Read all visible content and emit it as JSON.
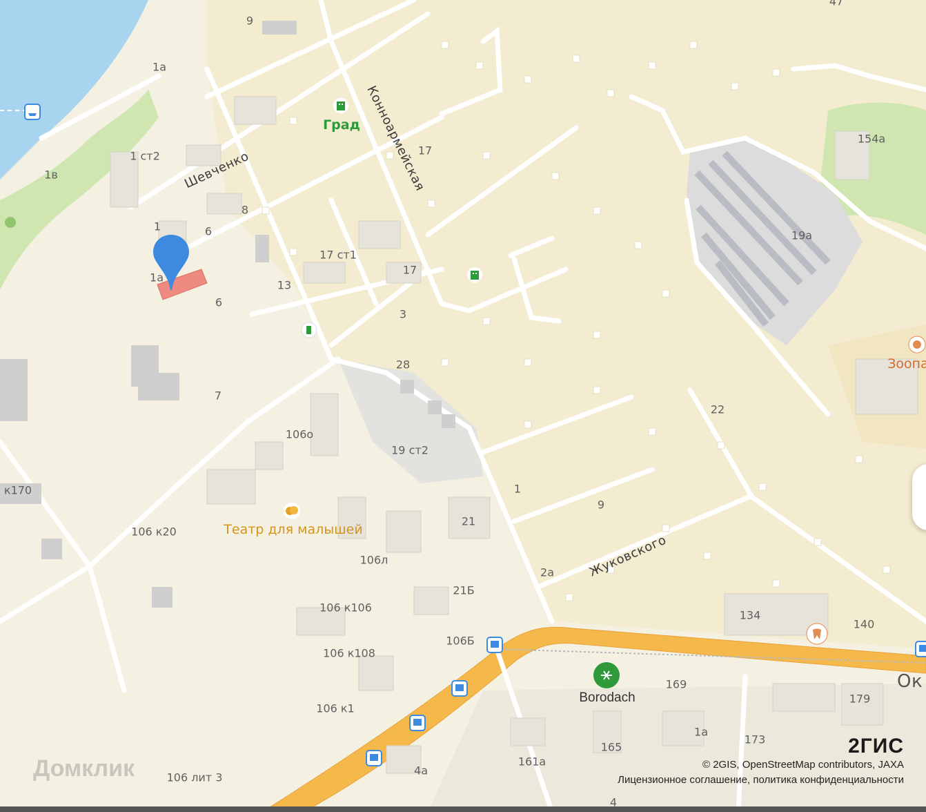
{
  "map": {
    "colors": {
      "water": "#a9d4ef",
      "land": "#f5f1e2",
      "residential": "#f4ecd0",
      "park": "#cfe6b0",
      "building": "#e8e4d8",
      "road_major": "#f4b94a",
      "road_minor": "#ffffff",
      "selected_building": "#ef8a80",
      "pin": "#3d8ae0"
    },
    "streets": {
      "shevchenko": "Шевченко",
      "konnoarmeyskaya": "Конноармейская",
      "zhukovskogo": "Жуковского",
      "ok_partial": "Ок"
    },
    "pois": {
      "grad": "Град",
      "theater": "Театр для малышей",
      "borodach": "Borodach",
      "zoo": "Зоопа"
    },
    "house_numbers": [
      "9",
      "1а",
      "1 ст2",
      "1в",
      "8",
      "1",
      "6",
      "1а",
      "6",
      "13",
      "17",
      "17 ст1",
      "17",
      "3",
      "28",
      "7",
      "106о",
      "19 ст2",
      "1",
      "21",
      "9",
      "2а",
      "21Б",
      "106л",
      "106 к106",
      "106 к108",
      "106Б",
      "106 к1",
      "106 лит 3",
      "106 к20",
      "к170",
      "154а",
      "19а",
      "22",
      "134",
      "140",
      "169",
      "179",
      "1а",
      "173",
      "165",
      "161а",
      "4а",
      "4",
      "47"
    ]
  },
  "attribution": {
    "brand": "2ГИС",
    "line1": "© 2GIS, OpenStreetMap contributors, JAXA",
    "line2": "Лицензионное соглашение, политика конфиденциальности",
    "watermark": "Домклик"
  }
}
